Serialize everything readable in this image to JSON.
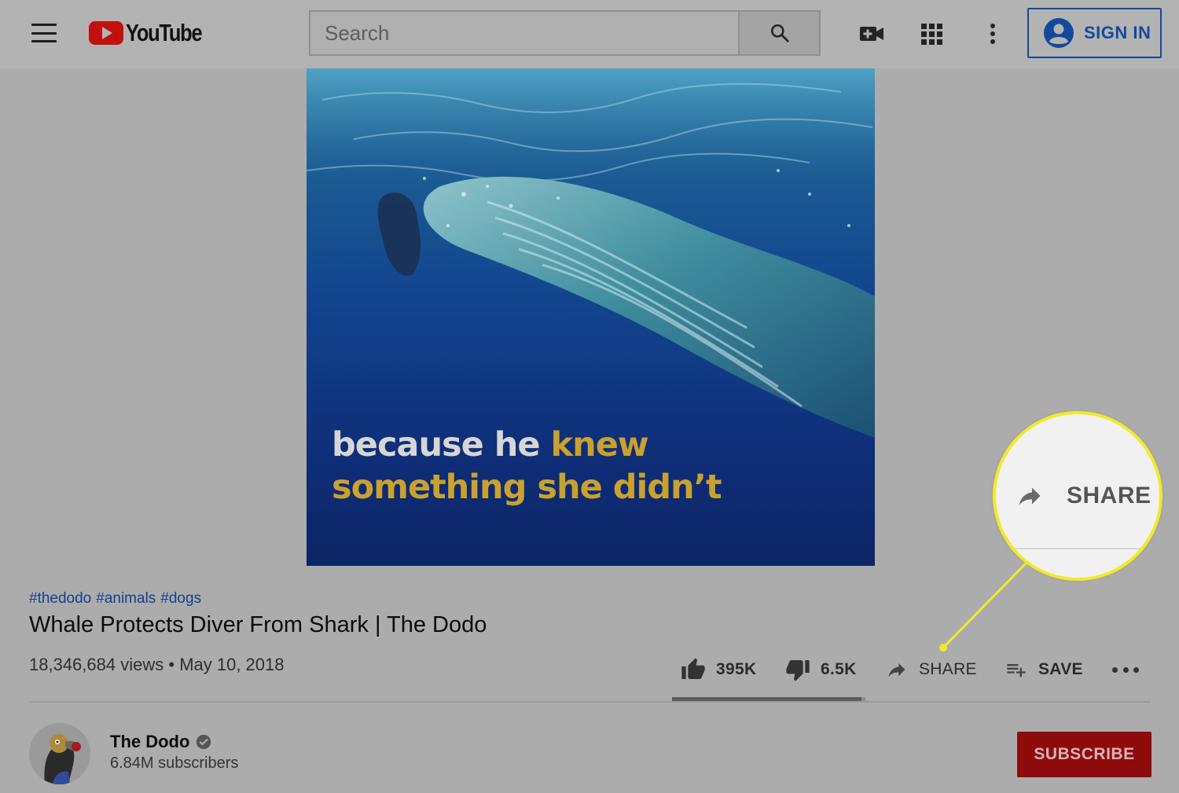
{
  "header": {
    "logo_text": "YouTube",
    "search": {
      "placeholder": "Search",
      "value": ""
    },
    "sign_in_label": "SIGN IN"
  },
  "video": {
    "caption_line1_white": "because he ",
    "caption_line1_gold": "knew",
    "caption_line2_gold": "something she didn’t"
  },
  "info": {
    "hashtags": [
      "#thedodo",
      "#animals",
      "#dogs"
    ],
    "title": "Whale Protects Diver From Shark | The Dodo",
    "views": "18,346,684 views",
    "separator": "•",
    "date": "May 10, 2018"
  },
  "actions": {
    "like_count": "395K",
    "dislike_count": "6.5K",
    "share_label": "SHARE",
    "save_label": "SAVE",
    "like_ratio": 0.98
  },
  "channel": {
    "name": "The Dodo",
    "subscribers": "6.84M subscribers",
    "subscribe_label": "SUBSCRIBE"
  },
  "callout": {
    "label": "SHARE",
    "highlight_color": "#f2ea2a"
  },
  "colors": {
    "brand_red": "#c21010",
    "link_blue": "#12408f",
    "subscribe_red": "#8e0b0b"
  },
  "icons": {
    "menu": "menu-icon",
    "search": "search-icon",
    "upload": "video-camera-plus-icon",
    "apps": "apps-grid-icon",
    "more": "more-vertical-icon",
    "account": "account-circle-icon",
    "like": "thumbs-up-icon",
    "dislike": "thumbs-down-icon",
    "share": "share-arrow-icon",
    "save": "playlist-add-icon",
    "more_actions": "more-horizontal-icon",
    "verified": "verified-check-icon"
  }
}
